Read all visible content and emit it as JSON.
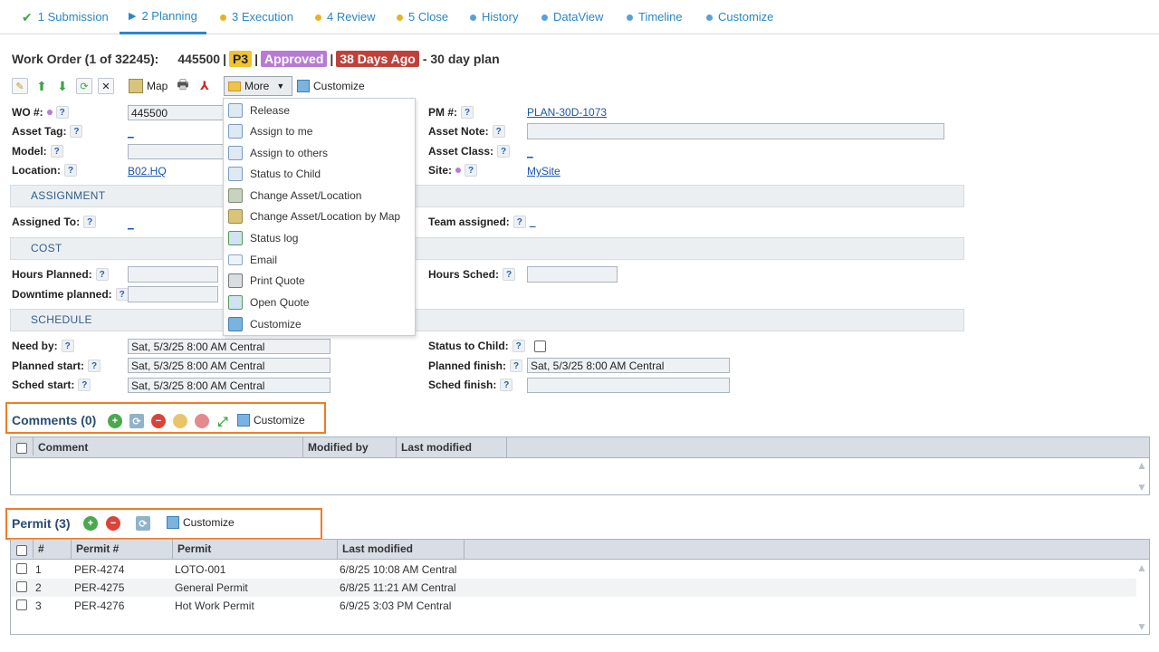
{
  "tabs": [
    {
      "label": "1 Submission",
      "icon": "check-icon"
    },
    {
      "label": "2 Planning",
      "icon": "play-icon",
      "active": true
    },
    {
      "label": "3 Execution",
      "icon": "yellow-dot-icon"
    },
    {
      "label": "4 Review",
      "icon": "yellow-dot-icon"
    },
    {
      "label": "5 Close",
      "icon": "yellow-dot-icon"
    },
    {
      "label": "History",
      "icon": "blue-dot-icon"
    },
    {
      "label": "DataView",
      "icon": "blue-dot-icon"
    },
    {
      "label": "Timeline",
      "icon": "blue-dot-icon"
    },
    {
      "label": "Customize",
      "icon": "blue-dot-icon"
    }
  ],
  "header": {
    "prefix": "Work Order (1 of 32245):",
    "wo_number": "445500",
    "sep1": "|",
    "priority": "P3",
    "sep2": "|",
    "status": "Approved",
    "sep3": "|",
    "age": "38 Days Ago",
    "suffix": "- 30 day plan"
  },
  "toolbar": {
    "map_label": "Map",
    "more_label": "More",
    "customize_label": "Customize"
  },
  "more_menu": [
    {
      "label": "Release",
      "icon": "document-icon"
    },
    {
      "label": "Assign to me",
      "icon": "document-icon"
    },
    {
      "label": "Assign to others",
      "icon": "document-icon"
    },
    {
      "label": "Status to Child",
      "icon": "document-icon"
    },
    {
      "label": "Change Asset/Location",
      "icon": "building-icon"
    },
    {
      "label": "Change Asset/Location by Map",
      "icon": "map-icon"
    },
    {
      "label": "Status log",
      "icon": "log-icon"
    },
    {
      "label": "Email",
      "icon": "email-icon"
    },
    {
      "label": "Print Quote",
      "icon": "printer-icon"
    },
    {
      "label": "Open Quote",
      "icon": "open-icon"
    },
    {
      "label": "Customize",
      "icon": "customize-icon"
    }
  ],
  "help_mark": "?",
  "form": {
    "wo_label": "WO #:",
    "wo_value": "445500",
    "asset_tag_label": "Asset Tag:",
    "asset_tag_value": "_",
    "model_label": "Model:",
    "model_value": "",
    "location_label": "Location:",
    "location_value": "B02.HQ",
    "pm_label": "PM #:",
    "pm_value": "PLAN-30D-1073",
    "asset_note_label": "Asset Note:",
    "asset_note_value": "",
    "asset_class_label": "Asset Class:",
    "asset_class_value": "_",
    "site_label": "Site:",
    "site_value": "MySite"
  },
  "sections": {
    "assignment": "ASSIGNMENT",
    "cost": "COST",
    "schedule": "SCHEDULE"
  },
  "assignment": {
    "assigned_to_label": "Assigned To:",
    "assigned_to_value": "_",
    "team_label": "Team assigned:",
    "team_value": "_"
  },
  "cost": {
    "hours_planned_label": "Hours Planned:",
    "hours_planned_value": "",
    "downtime_label": "Downtime planned:",
    "downtime_value": "",
    "hours_sched_label": "Hours Sched:",
    "hours_sched_value": ""
  },
  "schedule": {
    "need_by_label": "Need by:",
    "need_by_value": "Sat, 5/3/25 8:00 AM Central",
    "planned_start_label": "Planned start:",
    "planned_start_value": "Sat, 5/3/25 8:00 AM Central",
    "sched_start_label": "Sched start:",
    "sched_start_value": "Sat, 5/3/25 8:00 AM Central",
    "status_child_label": "Status to Child:",
    "planned_finish_label": "Planned finish:",
    "planned_finish_value": "Sat, 5/3/25 8:00 AM Central",
    "sched_finish_label": "Sched finish:",
    "sched_finish_value": ""
  },
  "comments": {
    "title": "Comments (0)",
    "customize_label": "Customize",
    "columns": [
      "Comment",
      "Modified by",
      "Last modified"
    ]
  },
  "permit": {
    "title": "Permit (3)",
    "customize_label": "Customize",
    "columns": [
      "#",
      "Permit #",
      "Permit",
      "Last modified"
    ],
    "rows": [
      {
        "num": "1",
        "permit_no": "PER-4274",
        "permit": "LOTO-001",
        "modified": "6/8/25 10:08 AM Central"
      },
      {
        "num": "2",
        "permit_no": "PER-4275",
        "permit": "General Permit",
        "modified": "6/8/25 11:21 AM Central"
      },
      {
        "num": "3",
        "permit_no": "PER-4276",
        "permit": "Hot Work Permit",
        "modified": "6/9/25 3:03 PM Central"
      }
    ]
  }
}
